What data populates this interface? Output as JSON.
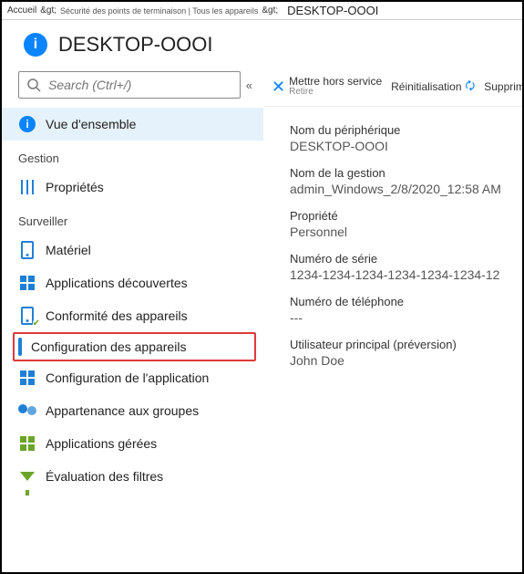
{
  "breadcrumb": {
    "home": "Accueil",
    "sep1": "&gt;",
    "mid": "Sécurité des points de terminaison | Tous les appareils",
    "sep2": "&gt;",
    "title": "DESKTOP-OOOI"
  },
  "header": {
    "title": "DESKTOP-OOOI"
  },
  "search": {
    "placeholder": "Search (Ctrl+/)"
  },
  "nav": {
    "overview": "Vue d'ensemble",
    "group_manage": "Gestion",
    "properties": "Propriétés",
    "group_monitor": "Surveiller",
    "hardware": "Matériel",
    "discovered_apps": "Applications découvertes",
    "device_compliance": "Conformité des appareils",
    "device_config": "Configuration des appareils",
    "app_config": "Configuration de l'application",
    "group_membership": "Appartenance aux groupes",
    "managed_apps": "Applications gérées",
    "filter_eval": "Évaluation des filtres"
  },
  "actions": {
    "retire": "Mettre hors service",
    "retire2": "Retire",
    "reset": "Réinitialisation",
    "delete": "Supprimer"
  },
  "details": {
    "device_name_label": "Nom du périphérique",
    "device_name_value": "DESKTOP-OOOI",
    "mgmt_name_label": "Nom de la gestion",
    "mgmt_name_value": "admin_Windows_2/8/2020_12:58 AM",
    "ownership_label": "Propriété",
    "ownership_value": "Personnel",
    "serial_label": "Numéro de série",
    "serial_value": "1234-1234-1234-1234-1234-1234-12",
    "phone_label": "Numéro de téléphone",
    "phone_value": "---",
    "user_label": "Utilisateur principal (préversion)",
    "user_value": "John Doe"
  }
}
